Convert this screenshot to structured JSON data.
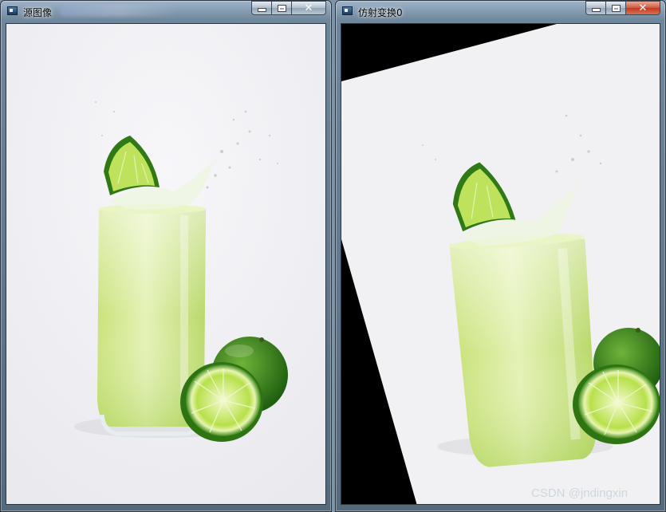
{
  "windows": [
    {
      "title": "源图像",
      "close_label": "✕"
    },
    {
      "title": "仿射变换0",
      "close_label": "✕"
    }
  ],
  "watermark": "CSDN @jndingxin",
  "colors": {
    "lime_light": "#d9ec9a",
    "lime_mid": "#a9d25a",
    "lime_dark": "#3f8a1e",
    "background": "#f2f2f5"
  },
  "icons": [
    "app-icon",
    "minimize-icon",
    "maximize-icon",
    "close-icon"
  ]
}
